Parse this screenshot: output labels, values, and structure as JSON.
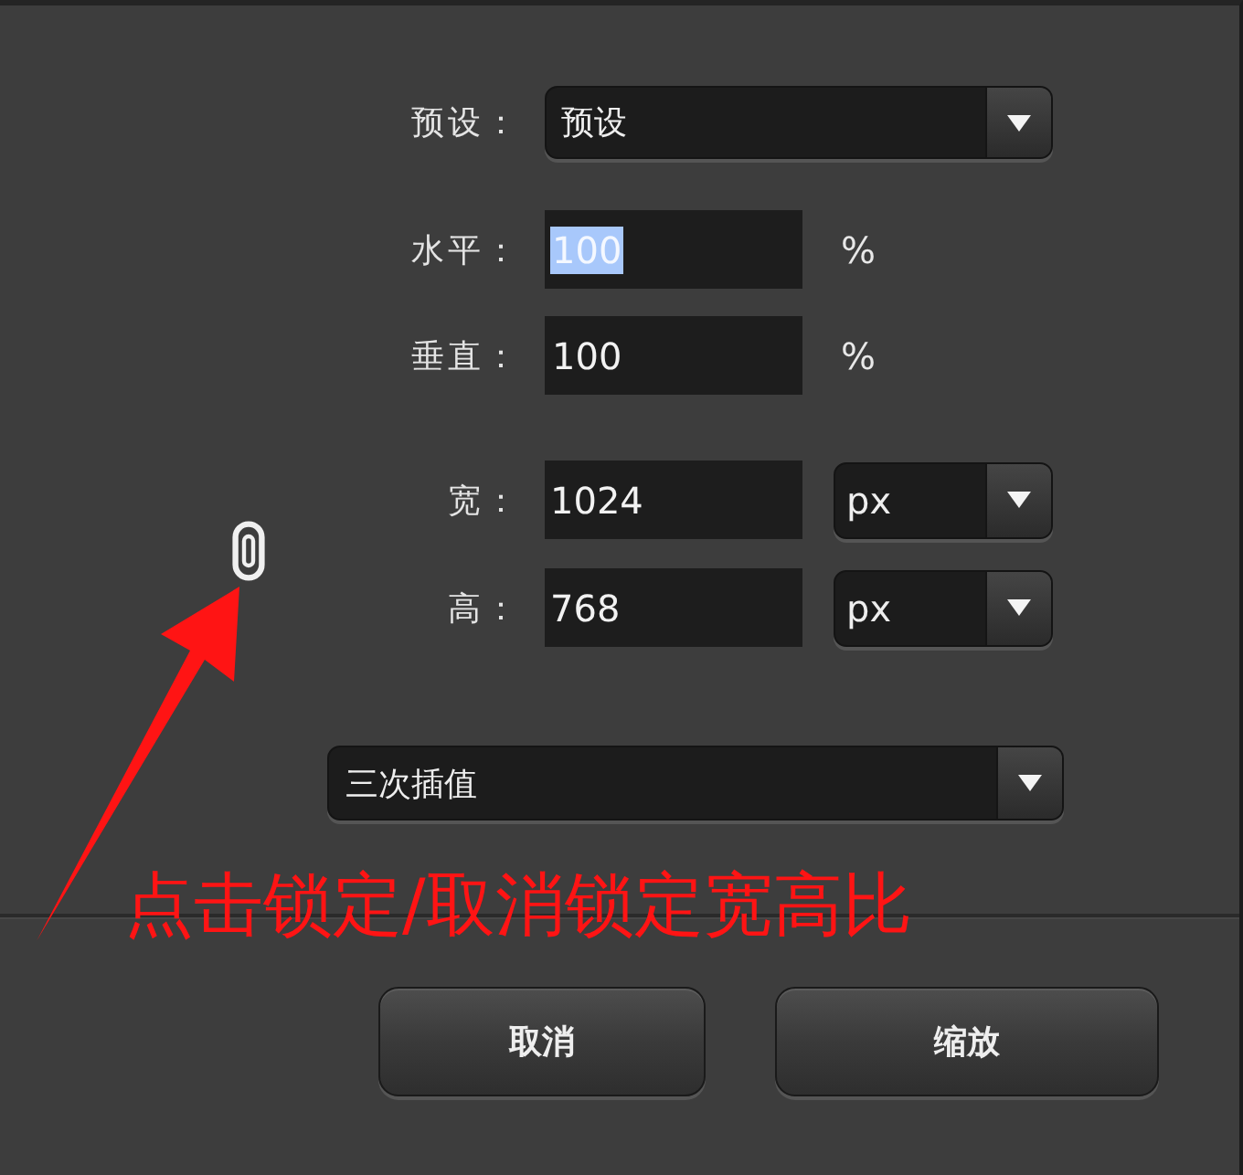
{
  "preset": {
    "label": "预设：",
    "value": "预设"
  },
  "scale_fields": [
    {
      "label": "水平：",
      "value": "100",
      "unit": "%",
      "text_selected": true
    },
    {
      "label": "垂直：",
      "value": "100",
      "unit": "%",
      "text_selected": false
    }
  ],
  "size_fields": [
    {
      "label": "宽：",
      "value": "1024",
      "unit": "px"
    },
    {
      "label": "高：",
      "value": "768",
      "unit": "px"
    }
  ],
  "interpolation": {
    "value": "三次插值"
  },
  "annotation": {
    "text": "点击锁定/取消锁定宽高比"
  },
  "buttons": [
    {
      "label": "取消"
    },
    {
      "label": "缩放"
    }
  ]
}
